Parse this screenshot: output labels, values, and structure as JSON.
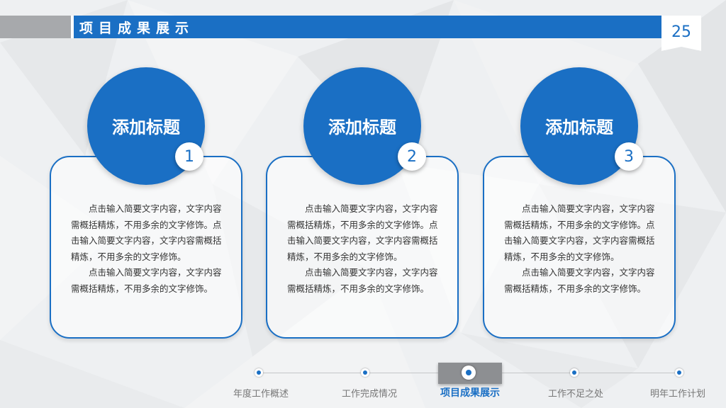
{
  "header": {
    "title": "项目成果展示",
    "page_number": "25"
  },
  "cards": [
    {
      "title": "添加标题",
      "number": "1",
      "paragraphs": [
        "点击输入简要文字内容，文字内容需概括精炼，不用多余的文字修饰。点击输入简要文字内容，文字内容需概括精炼，不用多余的文字修饰。",
        "点击输入简要文字内容，文字内容需概括精炼，不用多余的文字修饰。"
      ]
    },
    {
      "title": "添加标题",
      "number": "2",
      "paragraphs": [
        "点击输入简要文字内容，文字内容需概括精炼，不用多余的文字修饰。点击输入简要文字内容，文字内容需概括精炼，不用多余的文字修饰。",
        "点击输入简要文字内容，文字内容需概括精炼，不用多余的文字修饰。"
      ]
    },
    {
      "title": "添加标题",
      "number": "3",
      "paragraphs": [
        "点击输入简要文字内容，文字内容需概括精炼，不用多余的文字修饰。点击输入简要文字内容，文字内容需概括精炼，不用多余的文字修饰。",
        "点击输入简要文字内容，文字内容需概括精炼，不用多余的文字修饰。"
      ]
    }
  ],
  "nav": {
    "items": [
      {
        "label": "年度工作概述",
        "active": false
      },
      {
        "label": "工作完成情况",
        "active": false
      },
      {
        "label": "项目成果展示",
        "active": true
      },
      {
        "label": "工作不足之处",
        "active": false
      },
      {
        "label": "明年工作计划",
        "active": false
      }
    ]
  },
  "colors": {
    "accent": "#1a6fc4",
    "header_gray": "#a7a9ac",
    "nav_active_bg": "#8d8f92",
    "background": "#eef0f2"
  }
}
